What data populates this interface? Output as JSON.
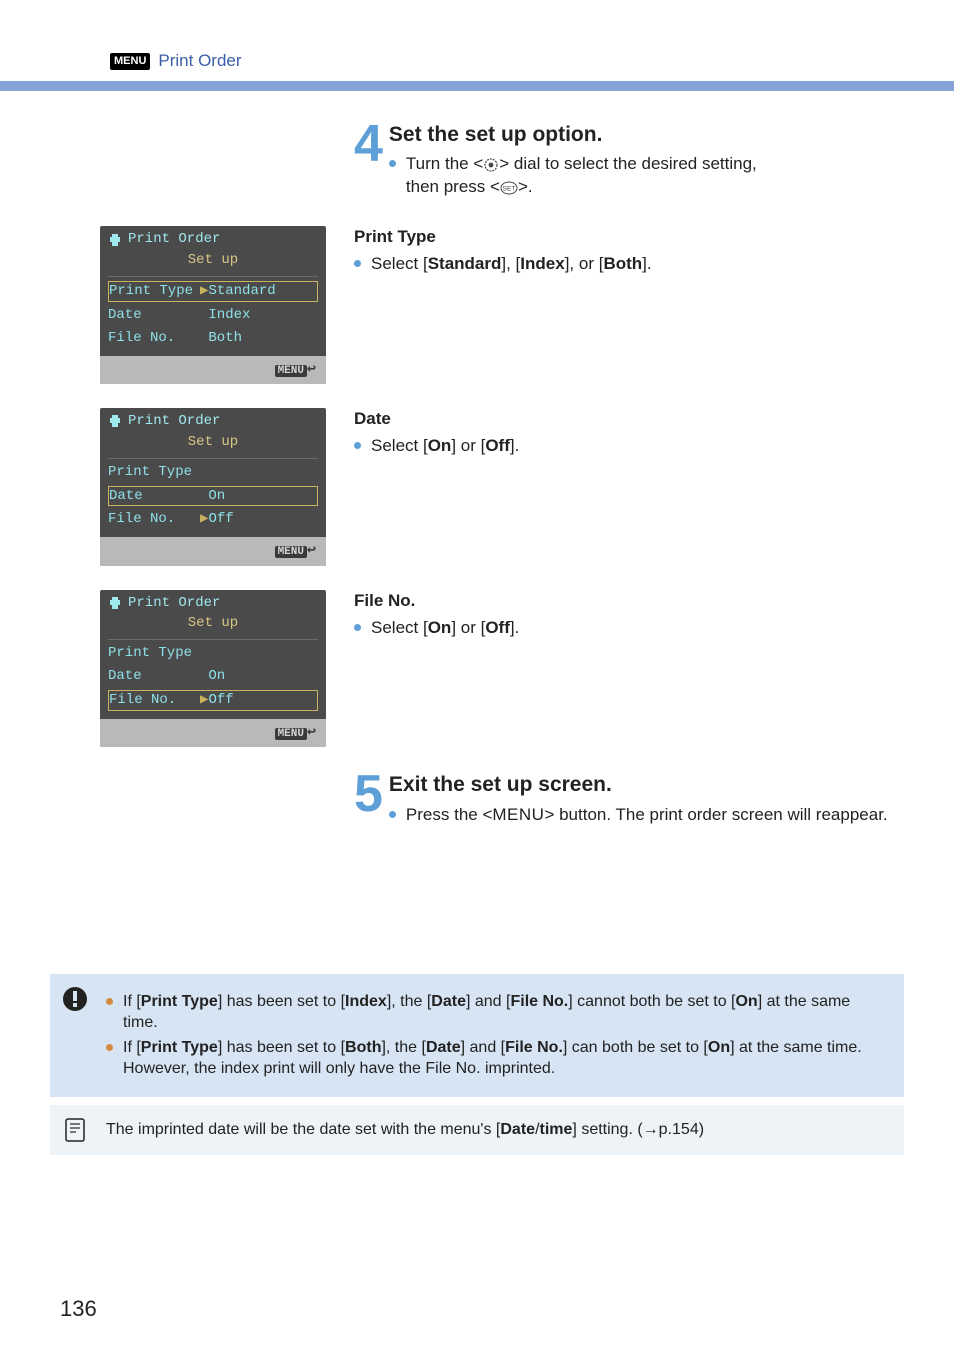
{
  "header": {
    "menu_label": "MENU",
    "title": "Print Order"
  },
  "step4": {
    "num": "4",
    "heading": "Set the set up option.",
    "line1_prefix": "Turn the <",
    "line1_suffix": "> dial to select the desired setting,",
    "line2_prefix": "then press <",
    "line2_suffix": ">."
  },
  "print_type": {
    "heading": "Print Type",
    "text_a": "Select [",
    "bold1": "Standard",
    "mid1": "], [",
    "bold2": "Index",
    "mid2": "], or [",
    "bold3": "Both",
    "tail": "]."
  },
  "date_sect": {
    "heading": "Date",
    "text_a": "Select [",
    "bold1": "On",
    "mid": "] or [",
    "bold2": "Off",
    "tail": "]."
  },
  "file_sect": {
    "heading": "File No.",
    "text_a": "Select [",
    "bold1": "On",
    "mid": "] or [",
    "bold2": "Off",
    "tail": "]."
  },
  "step5": {
    "num": "5",
    "heading": "Exit the set up screen.",
    "line_a": "Press the <",
    "menu_word": "MENU",
    "line_b": "> button. The print order screen will reappear."
  },
  "lcd_common": {
    "title": "Print Order",
    "setup": "Set up",
    "r1": "Print Type",
    "r2": "Date",
    "r3": "File No.",
    "menu": "MENU",
    "standard": "Standard",
    "index": "Index",
    "both": "Both",
    "on": "On",
    "off": "Off"
  },
  "note1": {
    "a1": "If [",
    "b1": "Print Type",
    "a2": "] has been set to [",
    "b2": "Index",
    "a3": "], the [",
    "b3": "Date",
    "a4": "] and [",
    "b4": "File No.",
    "a5": "] cannot both be set to [",
    "b5": "On",
    "a6": "] at the same time."
  },
  "note2": {
    "a1": "If [",
    "b1": "Print Type",
    "a2": "] has been set to [",
    "b2": "Both",
    "a3": "], the [",
    "b3": "Date",
    "a4": "] and [",
    "b4": "File No.",
    "a5": "] can both be set to [",
    "b5": "On",
    "a6": "] at the same time. However, the index print will only have the File No. imprinted."
  },
  "tip": {
    "a1": "The imprinted date will be the date set with the menu's [",
    "b1": "Date",
    "slash": "/",
    "b2": "time",
    "a2": "] setting. (→p.154)"
  },
  "page_number": "136"
}
